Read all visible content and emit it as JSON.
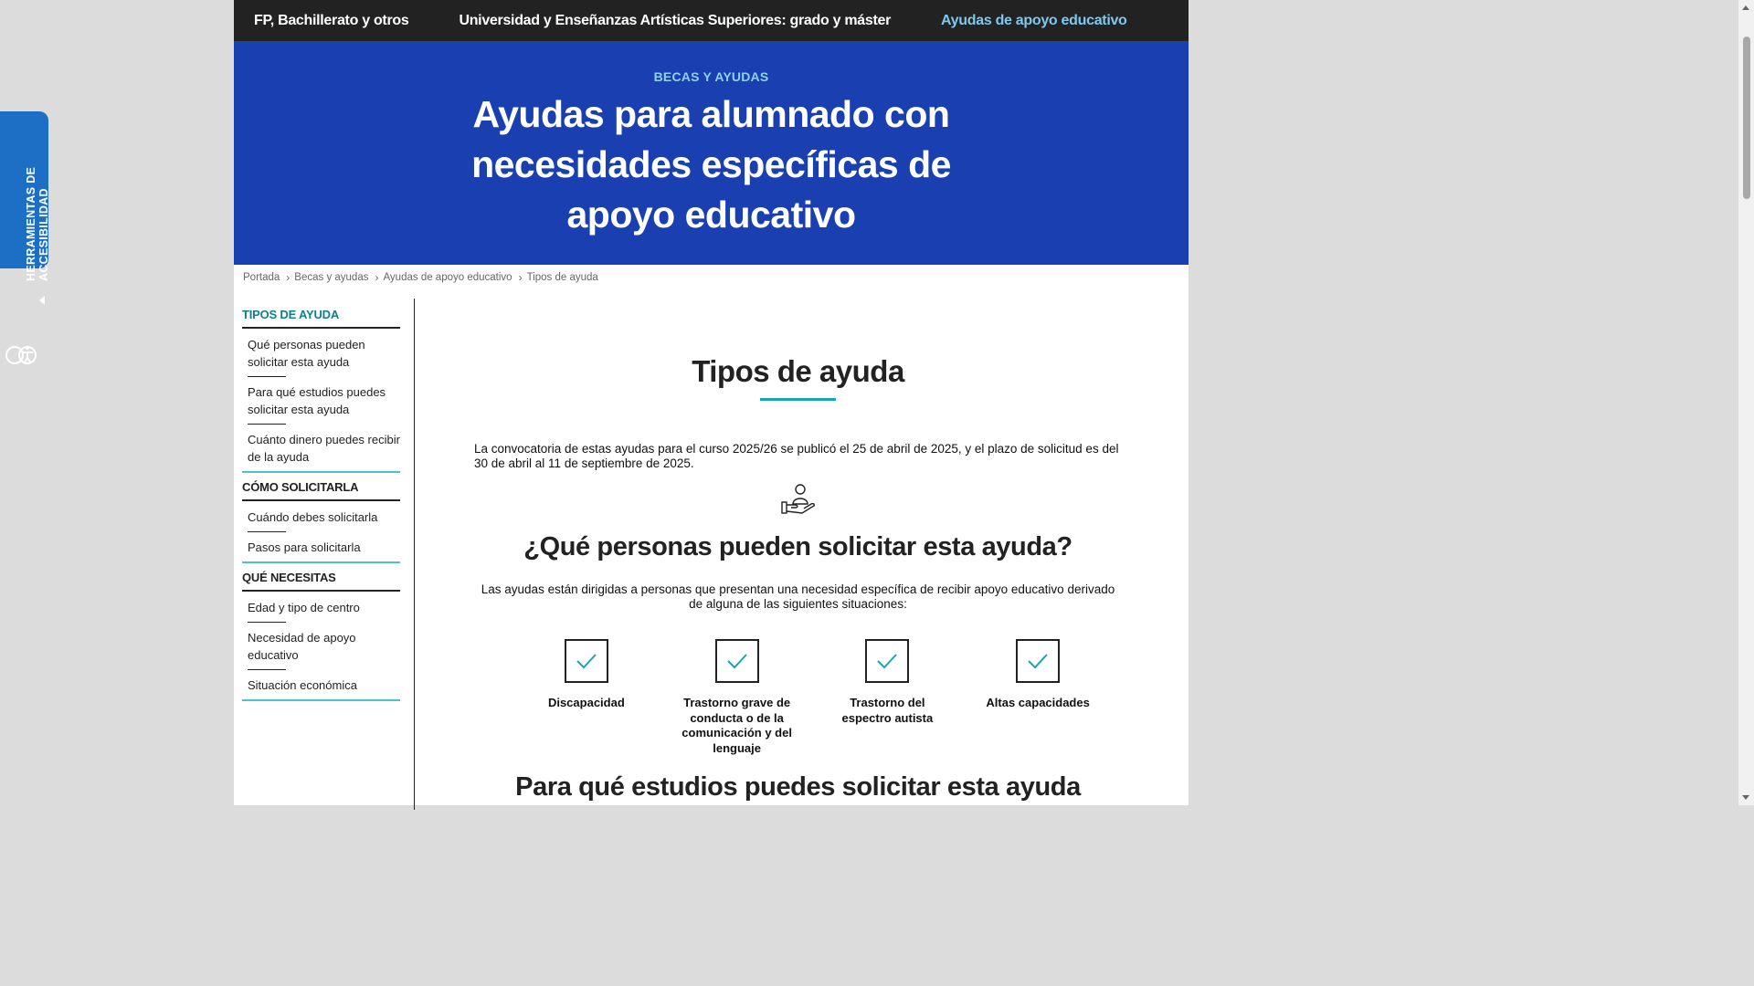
{
  "accessibility": {
    "label": "HERRAMIENTAS DE ACCESIBILIDAD",
    "icon": "accessibility-icon"
  },
  "topnav": {
    "items": [
      {
        "label": "FP, Bachillerato y otros",
        "active": false
      },
      {
        "label": "Universidad y Enseñanzas Artísticas Superiores: grado y máster",
        "active": false
      },
      {
        "label": "Ayudas de apoyo educativo",
        "active": true
      }
    ]
  },
  "hero": {
    "kicker": "BECAS Y AYUDAS",
    "title": "Ayudas para alumnado con necesidades específicas de apoyo educativo"
  },
  "breadcrumb": [
    "Portada",
    "Becas y ayudas",
    "Ayudas de apoyo educativo",
    "Tipos de ayuda"
  ],
  "sidebar": {
    "groups": [
      {
        "title": "TIPOS DE AYUDA",
        "items": [
          "Qué personas pueden solicitar esta ayuda",
          "Para qué estudios puedes solicitar esta ayuda",
          "Cuánto dinero puedes recibir de la ayuda"
        ]
      },
      {
        "title": "CÓMO SOLICITARLA",
        "items": [
          "Cuándo debes solicitarla",
          "Pasos para solicitarla"
        ]
      },
      {
        "title": "QUÉ NECESITAS",
        "items": [
          "Edad y tipo de centro",
          "Necesidad de apoyo educativo",
          "Situación económica"
        ]
      }
    ]
  },
  "main": {
    "title": "Tipos de ayuda",
    "intro": "La convocatoria de estas ayudas para el curso 2025/26 se publicó el 25 de abril de 2025, y el plazo de solicitud es del 30 de abril al 11 de septiembre de 2025.",
    "section_icon": "hand-person-icon",
    "section_title": "¿Qué personas pueden solicitar esta ayuda?",
    "section_desc": "Las ayudas están dirigidas a personas que presentan una necesidad específica de recibir apoyo educativo derivado de alguna de las siguientes situaciones:",
    "situations": [
      "Discapacidad",
      "Trastorno grave de conducta o de la comunicación y del lenguaje",
      "Trastorno del espectro autista",
      "Altas capacidades"
    ],
    "next_title": "Para qué estudios puedes solicitar esta ayuda"
  },
  "colors": {
    "nav_bg": "#222222",
    "hero_bg": "#1a3fb0",
    "accent_teal": "#1aa6ae",
    "a11y_blue": "#1c6fc4"
  }
}
